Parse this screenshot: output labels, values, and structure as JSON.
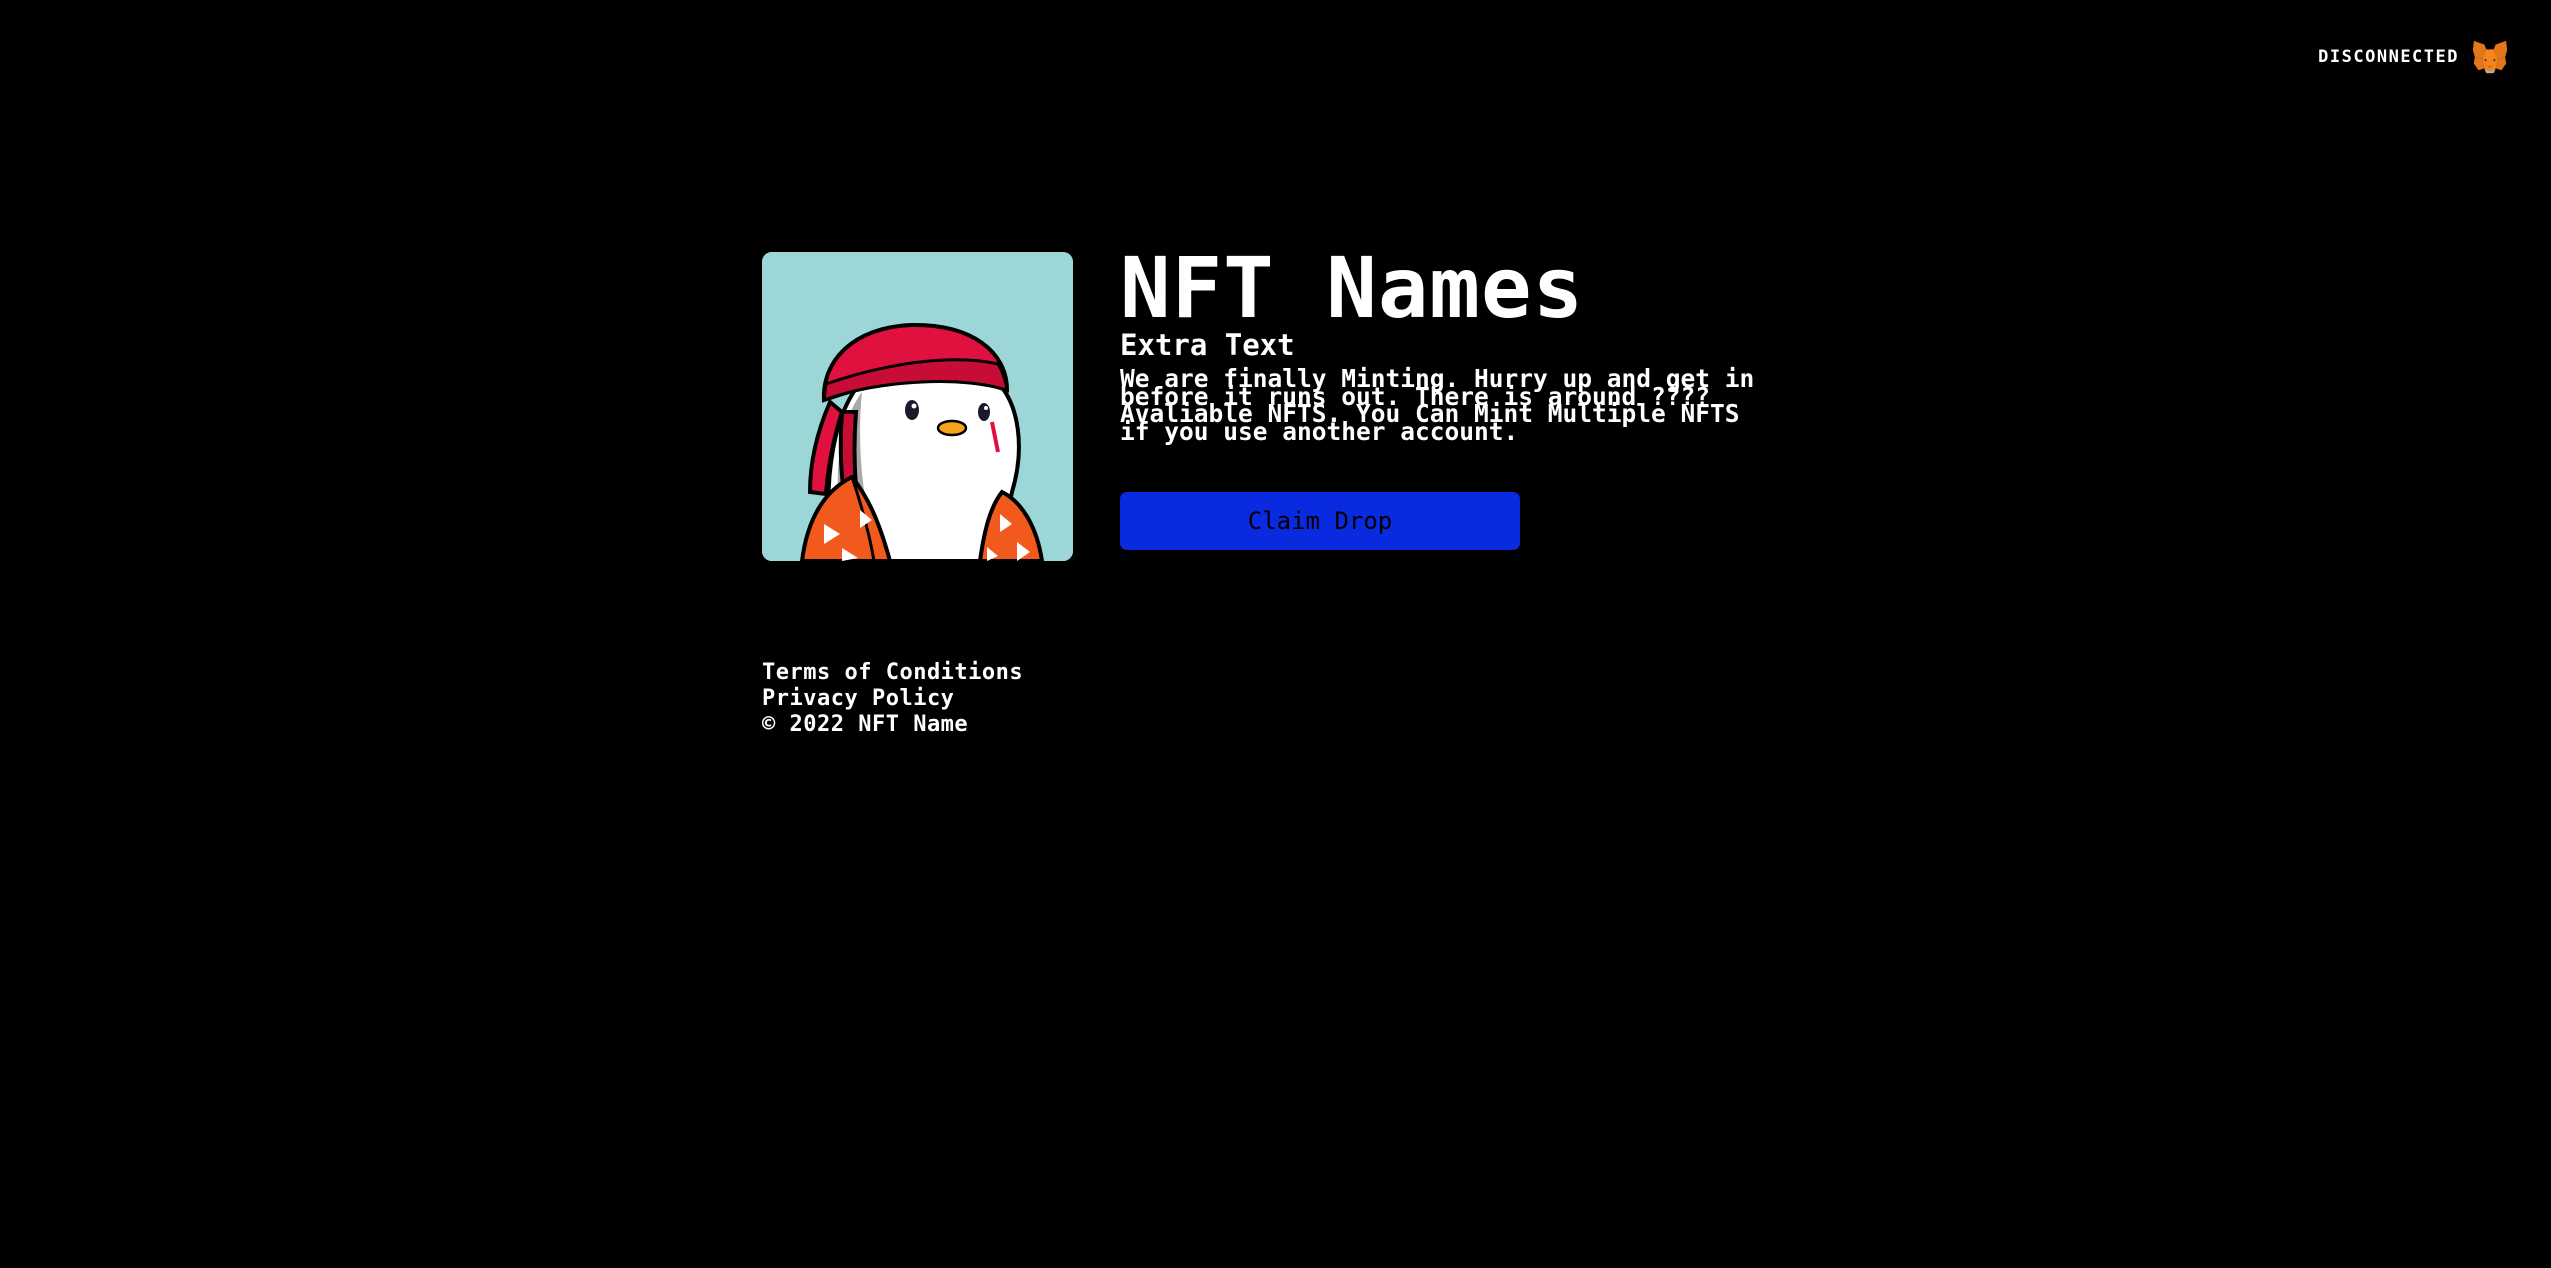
{
  "header": {
    "wallet_status": "DISCONNECTED",
    "wallet_icon": "metamask-fox-icon"
  },
  "hero": {
    "image_icon": "penguin-nft-avatar",
    "title": "NFT Names",
    "subtitle": "Extra Text",
    "description": "We are finally Minting. Hurry up and get in before it runs out. There is around ???? Avaliable NFTS. You Can Mint Multiple NFTS if you use another account.",
    "claim_button": "Claim Drop"
  },
  "footer": {
    "terms": "Terms of Conditions",
    "privacy": "Privacy Policy",
    "copyright": "© 2022 NFT Name"
  },
  "colors": {
    "background": "#000000",
    "text": "#ffffff",
    "button": "#0a2ae0",
    "avatar_bg": "#9dd6d6"
  }
}
